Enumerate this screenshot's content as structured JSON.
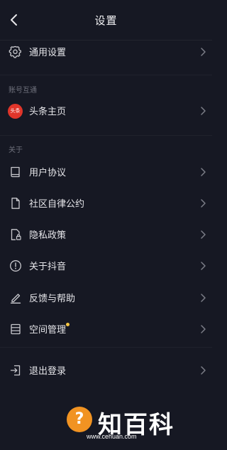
{
  "header": {
    "title": "设置"
  },
  "general": {
    "label": "通用设置"
  },
  "account": {
    "section_title": "账号互通",
    "toutiao": {
      "label": "头条主页",
      "avatar_text": "头条"
    }
  },
  "about": {
    "section_title": "关于",
    "items": [
      {
        "label": "用户协议",
        "icon": "book-icon"
      },
      {
        "label": "社区自律公约",
        "icon": "document-icon"
      },
      {
        "label": "隐私政策",
        "icon": "privacy-lock-icon"
      },
      {
        "label": "关于抖音",
        "icon": "info-icon"
      },
      {
        "label": "反馈与帮助",
        "icon": "edit-icon"
      },
      {
        "label": "空间管理",
        "icon": "storage-icon"
      }
    ]
  },
  "logout": {
    "label": "退出登录"
  },
  "watermark": {
    "brand": "知百科",
    "url": "www.cehuan.com"
  },
  "colors": {
    "background": "#161823",
    "badge": "#f5c542",
    "avatar_bg": "#e0352a"
  }
}
